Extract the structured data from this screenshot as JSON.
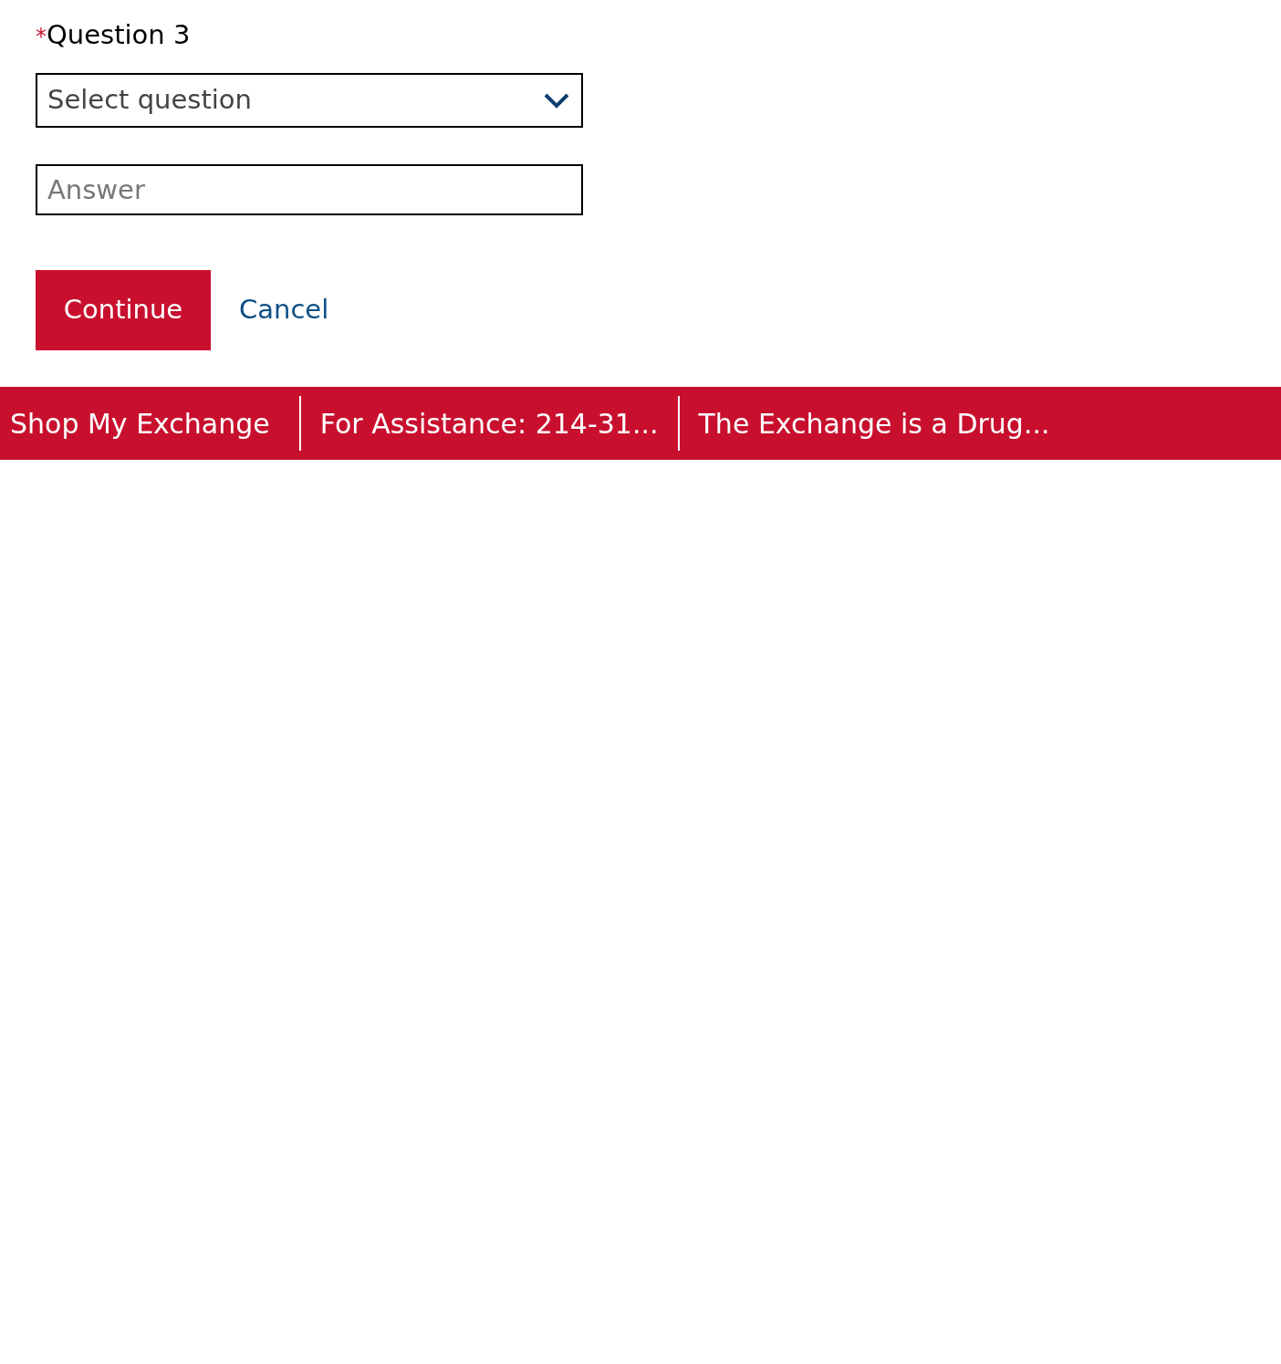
{
  "question": {
    "required_mark": "*",
    "label": "Question 3"
  },
  "select": {
    "placeholder": "Select question"
  },
  "answer": {
    "placeholder": "Answer"
  },
  "actions": {
    "primary": "Continue",
    "secondary": "Cancel"
  },
  "footer": {
    "links": [
      "Shop My Exchange",
      "For Assistance: 214-31...",
      "The Exchange is a Drug..."
    ]
  }
}
